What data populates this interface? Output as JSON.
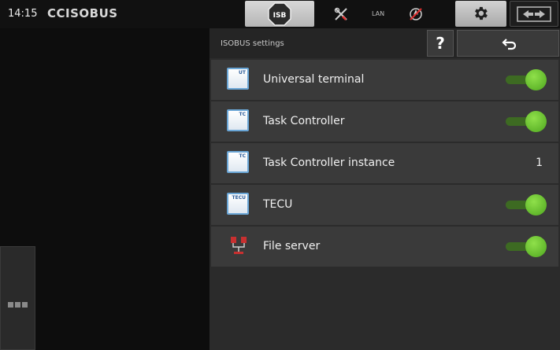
{
  "status": {
    "time": "14:15",
    "brand": "CCISOBUS",
    "lan_label": "LAN"
  },
  "header": {
    "title": "ISOBUS settings",
    "help_label": "?"
  },
  "rows": [
    {
      "icon": "universal-terminal-icon",
      "icon_tag": "UT",
      "label": "Universal terminal",
      "toggle_on": true
    },
    {
      "icon": "task-controller-icon",
      "icon_tag": "TC",
      "label": "Task Controller",
      "toggle_on": true
    },
    {
      "icon": "task-controller-icon",
      "icon_tag": "TC",
      "label": "Task Controller instance",
      "value": "1"
    },
    {
      "icon": "tecu-icon",
      "icon_tag": "TECU",
      "label": "TECU",
      "toggle_on": true
    },
    {
      "icon": "file-server-icon",
      "label": "File server",
      "toggle_on": true
    }
  ],
  "colors": {
    "toggle_on": "#5fbf2a",
    "panel": "#2b2b2b",
    "row": "#3a3a3a"
  }
}
